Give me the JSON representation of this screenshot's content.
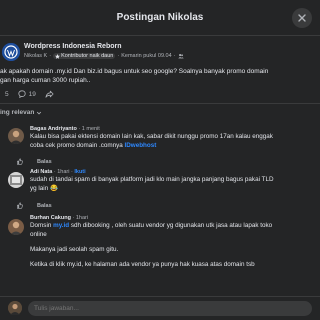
{
  "header": {
    "title": "Postingan Nikolas"
  },
  "post": {
    "group": "Wordpress Indonesia Reborn",
    "author": "Nikolas K",
    "badge": "Kontributor naik daun",
    "time": "Kemarin pukul 09.04",
    "separator": "·",
    "text_line1": "ak apakah domain .my.id Dan biz.id bagus untuk seo  google? Soalnya banyak promo domain",
    "text_line2": "gan harga cuman 3000 rupiah..",
    "reaction_count": "5",
    "comment_count": "19"
  },
  "sort": {
    "label": "ing relevan"
  },
  "comments": [
    {
      "name": "Bagas Andriyanto",
      "time": "1 menit",
      "lines": [
        "Kalau bisa pakai ektensi domain lain kak, sabar dikit nunggu promo 17an kalau enggak",
        "coba cek promo domain .comnya "
      ],
      "link": "IDwebhost",
      "reply": "Balas"
    },
    {
      "name": "Adi Nata",
      "time": "1hari",
      "follow": "Ikuti",
      "lines": [
        "sudah di tandai spam di banyak platform jadi klo main jangka panjang bagus pakai TLD",
        "yg lain 😂"
      ],
      "reply": "Balas"
    },
    {
      "name": "Burhan Cakung",
      "time": "1hari",
      "link": "my.id",
      "line1_prefix": "Domsin ",
      "line1_suffix": " sdh dibooking , oleh suatu vendor yg digunakan utk jasa atau lapak toko",
      "line2": "online",
      "line3": "Makanya jadi seolah spam gitu.",
      "line4": "Ketika di klik my.id, ke halaman ada vendor ya punya hak kuasa atas domain tsb"
    }
  ],
  "reply_bar": {
    "placeholder": "Tulis jawaban..."
  },
  "colors": {
    "accent": "#2d88ff",
    "background": "#242526",
    "divider": "#3a3b3c"
  }
}
